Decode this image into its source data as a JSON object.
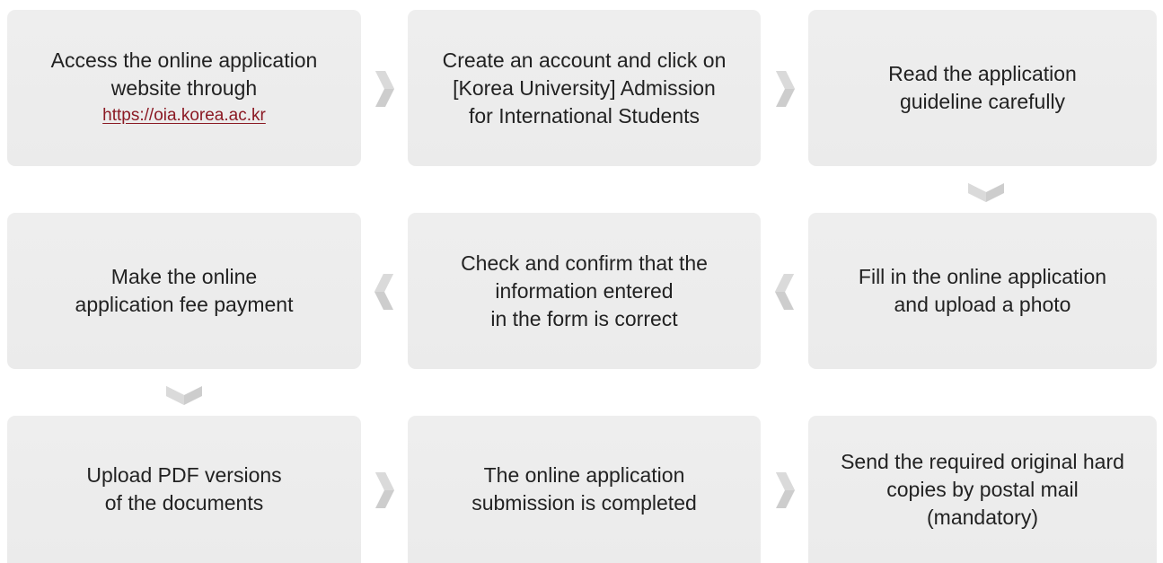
{
  "steps": [
    {
      "lines": [
        "Access the online application",
        "website through"
      ],
      "link": "https://oia.korea.ac.kr"
    },
    {
      "lines": [
        "Create an account and click on",
        "[Korea University] Admission",
        "for International Students"
      ]
    },
    {
      "lines": [
        "Read the application",
        "guideline carefully"
      ]
    },
    {
      "lines": [
        "Fill in the online application",
        "and upload a photo"
      ]
    },
    {
      "lines": [
        "Check and confirm that the",
        "information entered",
        "in the form is correct"
      ]
    },
    {
      "lines": [
        "Make the online",
        "application fee payment"
      ]
    },
    {
      "lines": [
        "Upload PDF versions",
        "of the documents"
      ]
    },
    {
      "lines": [
        "The online application",
        "submission is completed"
      ]
    },
    {
      "lines": [
        "Send the required original hard",
        "copies by postal mail",
        "(mandatory)"
      ]
    }
  ],
  "colors": {
    "box_background": "#ededed",
    "text": "#222222",
    "link": "#8b1a24",
    "arrow": "#c8c8c8"
  },
  "icons": {
    "arrow_right": "chevron-right-icon",
    "arrow_left": "chevron-left-icon",
    "arrow_down": "chevron-down-icon"
  }
}
